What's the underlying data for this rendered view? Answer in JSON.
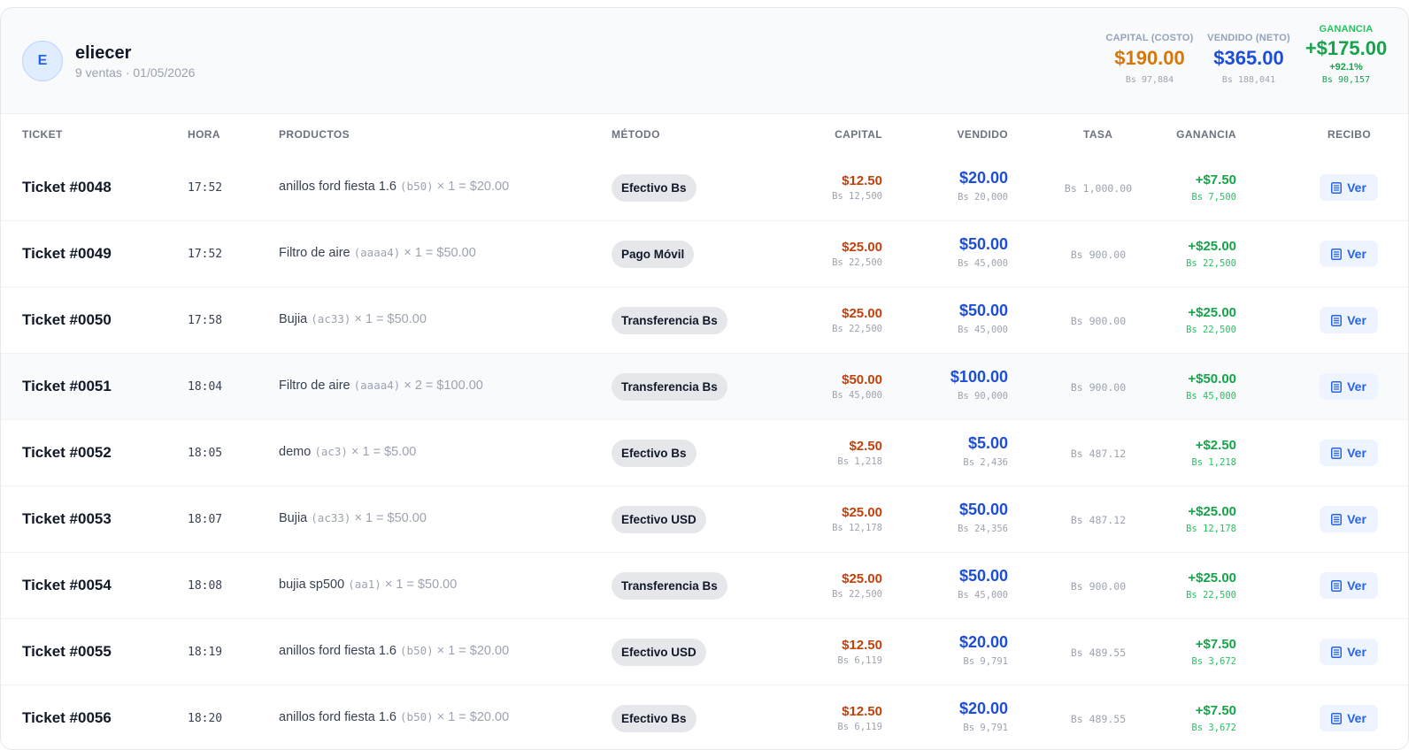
{
  "header": {
    "avatar_initial": "E",
    "user_name": "eliecer",
    "meta": "9 ventas · 01/05/2026",
    "capital": {
      "label": "CAPITAL (COSTO)",
      "value": "$190.00",
      "bs": "Bs 97,884"
    },
    "vendido": {
      "label": "VENDIDO (NETO)",
      "value": "$365.00",
      "bs": "Bs 188,041"
    },
    "ganancia": {
      "label": "GANANCIA",
      "value": "+$175.00",
      "pct": "+92.1%",
      "bs": "Bs 90,157"
    }
  },
  "columns": {
    "ticket": "TICKET",
    "hora": "HORA",
    "productos": "PRODUCTOS",
    "metodo": "MÉTODO",
    "capital": "CAPITAL",
    "vendido": "VENDIDO",
    "tasa": "TASA",
    "ganancia": "GANANCIA",
    "recibo": "RECIBO"
  },
  "icons": {
    "recibo": "document-list-icon"
  },
  "colors": {
    "capital": "#d97706",
    "vendido": "#1d4ed8",
    "ganancia": "#16a34a",
    "accent": "#2563eb"
  },
  "rows": [
    {
      "ticket": "Ticket #0048",
      "hora": "17:52",
      "prod_name": "anillos ford fiesta 1.6",
      "prod_code": "(b50)",
      "prod_rest": "× 1 = $20.00",
      "metodo": "Efectivo Bs",
      "capital": "$12.50",
      "capital_bs": "Bs 12,500",
      "vendido": "$20.00",
      "vendido_bs": "Bs 20,000",
      "tasa": "Bs 1,000.00",
      "ganancia": "+$7.50",
      "ganancia_bs": "Bs 7,500",
      "recibo": "Ver"
    },
    {
      "ticket": "Ticket #0049",
      "hora": "17:52",
      "prod_name": "Filtro de aire",
      "prod_code": "(aaaa4)",
      "prod_rest": "× 1 = $50.00",
      "metodo": "Pago Móvil",
      "capital": "$25.00",
      "capital_bs": "Bs 22,500",
      "vendido": "$50.00",
      "vendido_bs": "Bs 45,000",
      "tasa": "Bs 900.00",
      "ganancia": "+$25.00",
      "ganancia_bs": "Bs 22,500",
      "recibo": "Ver"
    },
    {
      "ticket": "Ticket #0050",
      "hora": "17:58",
      "prod_name": "Bujia",
      "prod_code": "(ac33)",
      "prod_rest": "× 1 = $50.00",
      "metodo": "Transferencia Bs",
      "capital": "$25.00",
      "capital_bs": "Bs 22,500",
      "vendido": "$50.00",
      "vendido_bs": "Bs 45,000",
      "tasa": "Bs 900.00",
      "ganancia": "+$25.00",
      "ganancia_bs": "Bs 22,500",
      "recibo": "Ver"
    },
    {
      "ticket": "Ticket #0051",
      "hora": "18:04",
      "prod_name": "Filtro de aire",
      "prod_code": "(aaaa4)",
      "prod_rest": "× 2 = $100.00",
      "metodo": "Transferencia Bs",
      "capital": "$50.00",
      "capital_bs": "Bs 45,000",
      "vendido": "$100.00",
      "vendido_bs": "Bs 90,000",
      "tasa": "Bs 900.00",
      "ganancia": "+$50.00",
      "ganancia_bs": "Bs 45,000",
      "recibo": "Ver"
    },
    {
      "ticket": "Ticket #0052",
      "hora": "18:05",
      "prod_name": "demo",
      "prod_code": "(ac3)",
      "prod_rest": "× 1 = $5.00",
      "metodo": "Efectivo Bs",
      "capital": "$2.50",
      "capital_bs": "Bs 1,218",
      "vendido": "$5.00",
      "vendido_bs": "Bs 2,436",
      "tasa": "Bs 487.12",
      "ganancia": "+$2.50",
      "ganancia_bs": "Bs 1,218",
      "recibo": "Ver"
    },
    {
      "ticket": "Ticket #0053",
      "hora": "18:07",
      "prod_name": "Bujia",
      "prod_code": "(ac33)",
      "prod_rest": "× 1 = $50.00",
      "metodo": "Efectivo USD",
      "capital": "$25.00",
      "capital_bs": "Bs 12,178",
      "vendido": "$50.00",
      "vendido_bs": "Bs 24,356",
      "tasa": "Bs 487.12",
      "ganancia": "+$25.00",
      "ganancia_bs": "Bs 12,178",
      "recibo": "Ver"
    },
    {
      "ticket": "Ticket #0054",
      "hora": "18:08",
      "prod_name": "bujia sp500",
      "prod_code": "(aa1)",
      "prod_rest": "× 1 = $50.00",
      "metodo": "Transferencia Bs",
      "capital": "$25.00",
      "capital_bs": "Bs 22,500",
      "vendido": "$50.00",
      "vendido_bs": "Bs 45,000",
      "tasa": "Bs 900.00",
      "ganancia": "+$25.00",
      "ganancia_bs": "Bs 22,500",
      "recibo": "Ver"
    },
    {
      "ticket": "Ticket #0055",
      "hora": "18:19",
      "prod_name": "anillos ford fiesta 1.6",
      "prod_code": "(b50)",
      "prod_rest": "× 1 = $20.00",
      "metodo": "Efectivo USD",
      "capital": "$12.50",
      "capital_bs": "Bs 6,119",
      "vendido": "$20.00",
      "vendido_bs": "Bs 9,791",
      "tasa": "Bs 489.55",
      "ganancia": "+$7.50",
      "ganancia_bs": "Bs 3,672",
      "recibo": "Ver"
    },
    {
      "ticket": "Ticket #0056",
      "hora": "18:20",
      "prod_name": "anillos ford fiesta 1.6",
      "prod_code": "(b50)",
      "prod_rest": "× 1 = $20.00",
      "metodo": "Efectivo Bs",
      "capital": "$12.50",
      "capital_bs": "Bs 6,119",
      "vendido": "$20.00",
      "vendido_bs": "Bs 9,791",
      "tasa": "Bs 489.55",
      "ganancia": "+$7.50",
      "ganancia_bs": "Bs 3,672",
      "recibo": "Ver"
    }
  ]
}
